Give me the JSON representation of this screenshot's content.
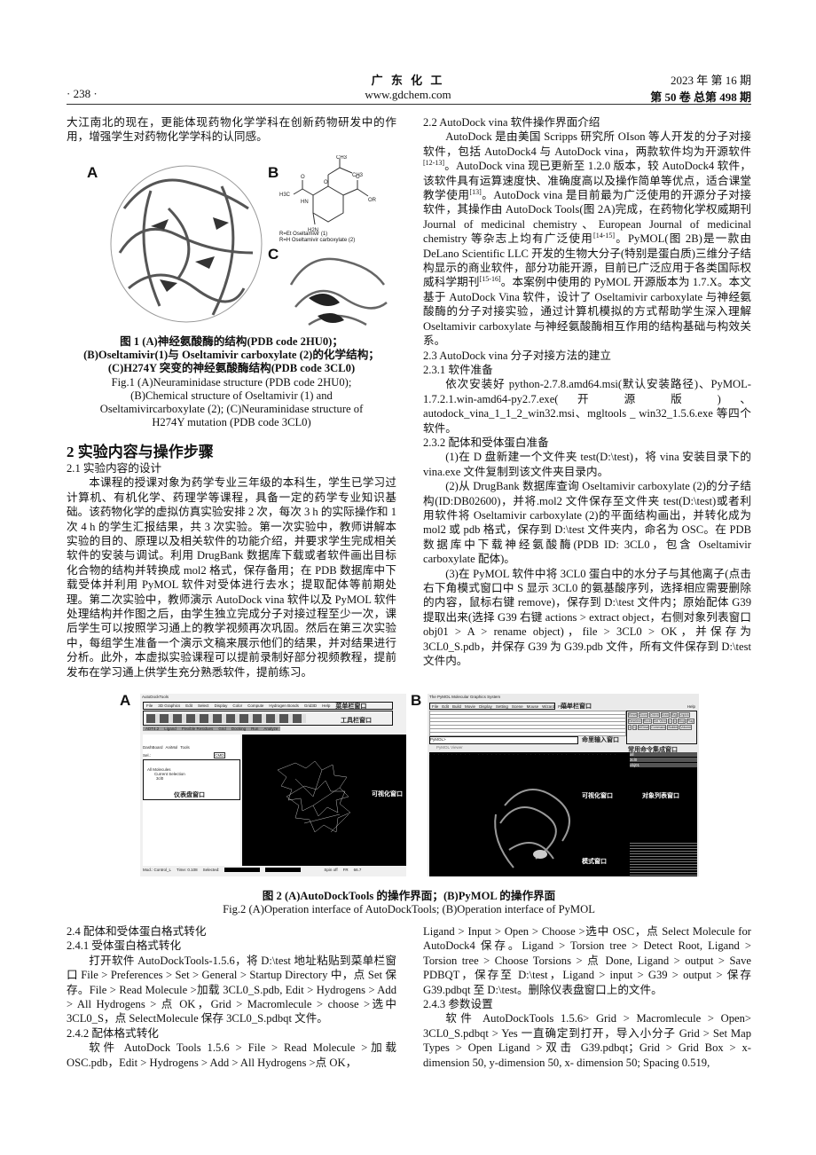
{
  "header": {
    "page_number": "· 238 ·",
    "journal": "广 东 化 工",
    "website": "www.gdchem.com",
    "issue": "2023 年 第 16 期",
    "volume": "第 50 卷 总第 498 期"
  },
  "left": {
    "intro": "大江南北的现在，更能体现药物化学学科在创新药物研发中的作用，增强学生对药物化学学科的认同感。",
    "section2_title": "2  实验内容与操作步骤",
    "s21_title": "2.1  实验内容的设计",
    "s21_text": "本课程的授课对象为药学专业三年级的本科生，学生已学习过计算机、有机化学、药理学等课程，具备一定的药学专业知识基础。该药物化学的虚拟仿真实验安排 2 次，每次 3 h 的实际操作和 1 次 4 h 的学生汇报结果，共 3 次实验。第一次实验中，教师讲解本实验的目的、原理以及相关软件的功能介绍，并要求学生完成相关软件的安装与调试。利用 DrugBank 数据库下载或者软件画出目标化合物的结构并转换成 mol2 格式，保存备用；在 PDB 数据库中下载受体并利用 PyMOL 软件对受体进行去水；提取配体等前期处理。第二次实验中，教师演示 AutoDock vina 软件以及 PyMOL 软件处理结构并作图之后，由学生独立完成分子对接过程至少一次，课后学生可以按照学习通上的教学视频再次巩固。然后在第三次实验中，每组学生准备一个演示文稿来展示他们的结果，并对结果进行分析。此外，本虚拟实验课程可以提前录制好部分视频教程，提前发布在学习通上供学生充分熟悉软件，提前练习。"
  },
  "figure1": {
    "panel_a": "A",
    "panel_b": "B",
    "panel_c": "C",
    "chem_labels": [
      "CH3",
      "CH3",
      "H3C",
      "O",
      "O",
      "HN",
      "O",
      "OR",
      "H2N"
    ],
    "r_et": "R=Et Oseltamivir (1)",
    "r_h": "R=H Oseltamivir carboxylate (2)",
    "caption_cn": [
      "图 1    (A)神经氨酸酶的结构(PDB code 2HU0)；",
      "(B)Oseltamivir(1)与 Oseltamivir carboxylate (2)的化学结构；",
      "(C)H274Y 突变的神经氨酸酶结构(PDB code 3CL0)"
    ],
    "caption_en": [
      "Fig.1    (A)Neuraminidase structure (PDB code 2HU0);",
      "(B)Chemical structure of Oseltamivir (1) and",
      "Oseltamivircarboxylate (2); (C)Neuraminidase structure of",
      "H274Y mutation (PDB code 3CL0)"
    ]
  },
  "right": {
    "s22_title": "2.2 AutoDock vina 软件操作界面介绍",
    "s22_parts": [
      "AutoDock 是由美国 Scripps 研究所 OIson 等人开发的分子对接软件，包括 AutoDock4 与 AutoDock vina，两款软件均为开源软件",
      {
        "sup": "[12-13]"
      },
      "。AutoDock vina 现已更新至 1.2.0 版本，较 AutoDock4 软件，该软件具有运算速度快、准确度高以及操作简单等优点，适合课堂教学使用",
      {
        "sup": "[13]"
      },
      "。AutoDock vina 是目前最为广泛使用的开源分子对接软件，其操作由 AutoDock Tools(图 2A)完成，在药物化学权威期刊 Journal of medicinal chemistry、European Journal of medicinal chemistry 等杂志上均有广泛使用",
      {
        "sup": "[14-15]"
      },
      "。PyMOL(图 2B)是一款由 DeLano Scientific LLC 开发的生物大分子(特别是蛋白质)三维分子结构显示的商业软件，部分功能开源，目前已广泛应用于各类国际权威科学期刊",
      {
        "sup": "[15-16]"
      },
      "。本案例中使用的 PyMOL 开源版本为 1.7.X。本文基于 AutoDock Vina 软件，设计了 Oseltamivir carboxylate 与神经氨酸酶的分子对接实验，通过计算机模拟的方式帮助学生深入理解 Oseltamivir carboxylate 与神经氨酸酶相互作用的结构基础与构效关系。"
    ],
    "s23_title": "2.3 AutoDock vina 分子对接方法的建立",
    "s231_title": "2.3.1  软件准备",
    "s231_text": "依次安装好 python-2.7.8.amd64.msi(默认安装路径)、PyMOL-1.7.2.1.win-amd64-py2.7.exe( 开 源 版 ) 、autodock_vina_1_1_2_win32.msi、mgltools _ win32_1.5.6.exe 等四个软件。",
    "s232_title": "2.3.2  配体和受体蛋白准备",
    "s232_p1": "(1)在 D 盘新建一个文件夹 test(D:\\test)，将 vina 安装目录下的 vina.exe 文件复制到该文件夹目录内。",
    "s232_p2": "(2)从 DrugBank 数据库查询 Oseltamivir carboxylate (2)的分子结构(ID:DB02600)，并将.mol2 文件保存至文件夹 test(D:\\test)或者利用软件将 Oseltamivir carboxylate (2)的平面结构画出，并转化成为 mol2 或 pdb 格式，保存到 D:\\test 文件夹内，命名为 OSC。在 PDB 数据库中下载神经氨酸酶(PDB ID: 3CL0，包含 Oseltamivir carboxylate 配体)。",
    "s232_p3": "(3)在 PyMOL 软件中将 3CL0 蛋白中的水分子与其他离子(点击右下角模式窗口中 S 显示 3CL0 的氨基酸序列，选择相应需要删除的内容，鼠标右键 remove)，保存到 D:\\test 文件内；原始配体 G39 提取出来(选择 G39 右键 actions > extract object，右侧对象列表窗口 obj01 > A > rename object)，file > 3CL0 > OK，并保存为 3CL0_S.pdb，并保存 G39 为 G39.pdb 文件，所有文件保存到 D:\\test 文件内。"
  },
  "figure2": {
    "panel_a": "A",
    "panel_b": "B",
    "a": {
      "window_title": "AutoDockTools",
      "menu": [
        "File",
        "3D Graphics",
        "Edit",
        "Select",
        "Display",
        "Color",
        "Compute",
        "Hydrogen Bonds",
        "Grid3D",
        "Help"
      ],
      "tabs": [
        "ADT4.2",
        "Ligand",
        "Flexible Residues",
        "Grid",
        "Docking",
        "Run",
        "Analyze"
      ],
      "panel_tabs": [
        "DashBoard",
        "AniMol",
        "Tools"
      ],
      "sel_label": "Sel.:",
      "cmd_label": "CMD",
      "tree": [
        "All Molecules",
        "Current Selection",
        "3cl0"
      ],
      "status": [
        "Mod.: Control_L",
        "Time: 0.108",
        "Selected:",
        "Spin off",
        "FR",
        "66.7"
      ],
      "ann_menu": "菜单栏窗口",
      "ann_toolbar": "工具栏窗口",
      "ann_dashboard": "仪表盘窗口",
      "ann_viewer": "可视化窗口"
    },
    "b": {
      "window_title": "The PyMOL Molecular Graphics System",
      "menu": [
        "File",
        "Edit",
        "Build",
        "Movie",
        "Display",
        "Setting",
        "Scene",
        "Mouse",
        "Wizard",
        "Plugin"
      ],
      "help": "Help",
      "buttons": [
        "Reset",
        "Zoom",
        "Orient",
        "Draw",
        "Ray",
        "Unpick",
        "Deselect",
        "Rock",
        "Get View",
        "|<",
        "<",
        "Stop",
        "Play",
        ">",
        ">|",
        "MClear",
        "Command",
        "Builder",
        "Volume"
      ],
      "prompt": "PyMOL>",
      "viewer_label": "PyMOL Viewer",
      "objects": [
        "all",
        "3cl0",
        "obj01"
      ],
      "ann_menu": "菜单栏窗口",
      "ann_cmd": "命里输入窗口",
      "ann_buttons": "常用命令集成窗口",
      "ann_viewer": "可视化窗口",
      "ann_objects": "对象列表窗口",
      "ann_mode": "模式窗口"
    },
    "caption_cn": [
      "图 2    (A)AutoDockTools 的操作界面；(B)PyMOL 的操作界面"
    ],
    "caption_en": "Fig.2    (A)Operation interface of AutoDockTools; (B)Operation interface of PyMOL"
  },
  "bottom_left": {
    "s24_title": "2.4  配体和受体蛋白格式转化",
    "s241_title": "2.4.1  受体蛋白格式转化",
    "s241_text": "打开软件 AutoDockTools-1.5.6，将 D:\\test 地址粘贴到菜单栏窗口 File > Preferences > Set > General > Startup Directory 中，点 Set 保存。File > Read Molecule >加载 3CL0_S.pdb, Edit > Hydrogens > Add > All Hydrogens > 点 OK，Grid > Macromlecule > choose >选中 3CL0_S，点 SelectMolecule 保存 3CL0_S.pdbqt 文件。",
    "s242_title": "2.4.2  配体格式转化",
    "s242_text": "软件 AutoDock Tools 1.5.6 > File > Read Molecule >加载 OSC.pdb，Edit > Hydrogens > Add > All Hydrogens >点 OK，"
  },
  "bottom_right": {
    "cont_text": "Ligand > Input > Open > Choose >选中 OSC，点 Select Molecule for AutoDock4 保存。Ligand > Torsion tree > Detect Root, Ligand > Torsion tree > Choose Torsions > 点 Done, Ligand > output > Save PDBQT，保存至 D:\\test，Ligand > input > G39 > output > 保存 G39.pdbqt 至 D:\\test。删除仪表盘窗口上的文件。",
    "s243_title": "2.4.3  参数设置",
    "s243_text": "软件 AutoDockTools 1.5.6> Grid > Macromlecule > Open> 3CL0_S.pdbqt > Yes 一直确定到打开，导入小分子 Grid > Set Map Types > Open Ligand >双击 G39.pdbqt；Grid > Grid Box > x-dimension 50, y-dimension 50, x- dimension 50; Spacing 0.519,"
  }
}
